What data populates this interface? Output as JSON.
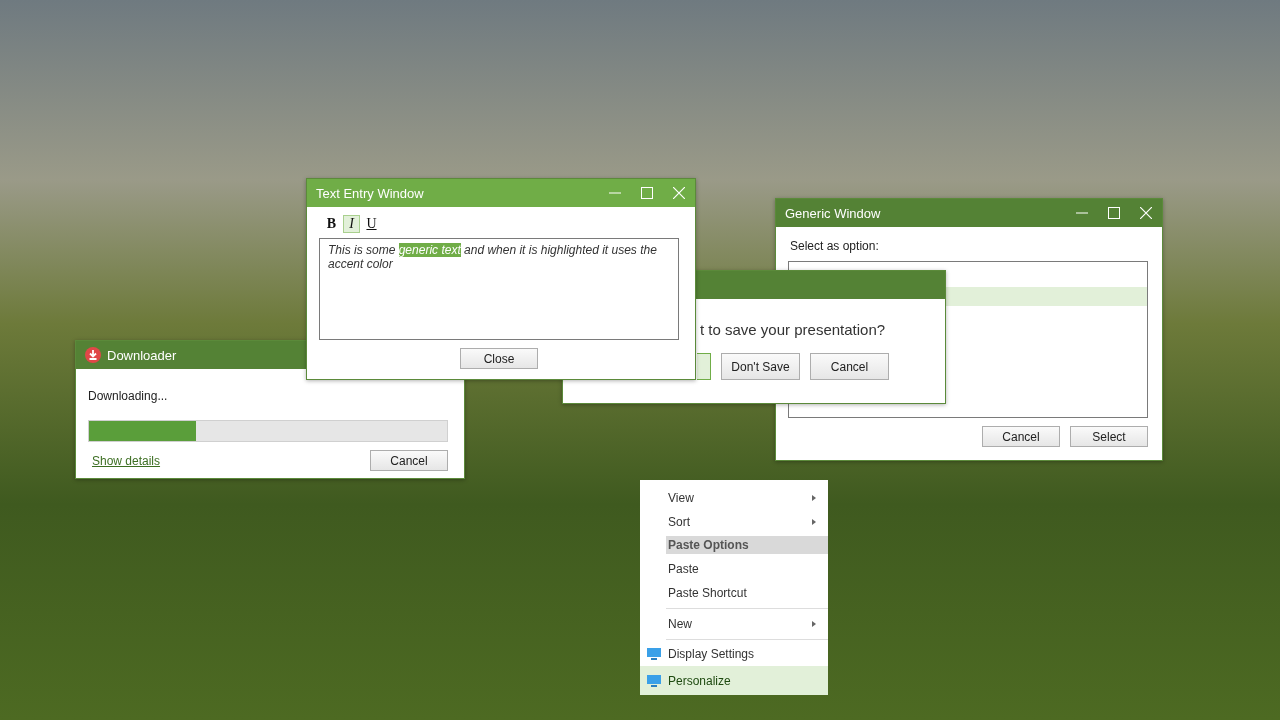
{
  "downloader": {
    "title": "Downloader",
    "status": "Downloading...",
    "progress": {
      "level": 0.3
    },
    "details_link": "Show details",
    "cancel": "Cancel"
  },
  "save_dialog": {
    "message": "t to save your presentation?",
    "buttons": [
      {
        "default": true
      },
      {
        "label": "Don't Save",
        "default": false
      },
      {
        "label": "Cancel",
        "default": false
      }
    ]
  },
  "text_entry_window": {
    "title": "Text Entry Window",
    "format_buttons": [
      {
        "label": "B",
        "kind": "bold",
        "selected": false
      },
      {
        "label": "I",
        "kind": "italic",
        "selected": true
      },
      {
        "label": "U",
        "kind": "underline",
        "selected": false
      }
    ],
    "text": [
      {
        "text": "This is some ",
        "highlighted": false
      },
      {
        "text": "generic text",
        "highlighted": true
      },
      {
        "text": " and when it is highlighted it uses the accent color",
        "highlighted": false
      }
    ],
    "close": "Close"
  },
  "generic_window": {
    "title": "Generic Window",
    "prompt": "Select as option:",
    "options": [
      {
        "selected": false
      },
      {
        "selected": true
      }
    ],
    "buttons": [
      "Cancel",
      "Select"
    ]
  },
  "context_menu": {
    "items": [
      {
        "kind": "item",
        "label": "View",
        "submenu": true,
        "selected": false
      },
      {
        "kind": "item",
        "label": "Sort",
        "submenu": true,
        "selected": false
      },
      {
        "kind": "header",
        "label": "Paste Options"
      },
      {
        "kind": "item",
        "label": "Paste",
        "submenu": false,
        "selected": false
      },
      {
        "kind": "item",
        "label": "Paste Shortcut",
        "submenu": false,
        "selected": false
      },
      {
        "kind": "separator"
      },
      {
        "kind": "item",
        "label": "New",
        "submenu": true,
        "selected": false
      },
      {
        "kind": "separator"
      },
      {
        "kind": "icon",
        "label": "Display Settings",
        "submenu": false,
        "selected": false
      },
      {
        "kind": "icon",
        "label": "Personalize",
        "submenu": false,
        "selected": true
      }
    ]
  }
}
